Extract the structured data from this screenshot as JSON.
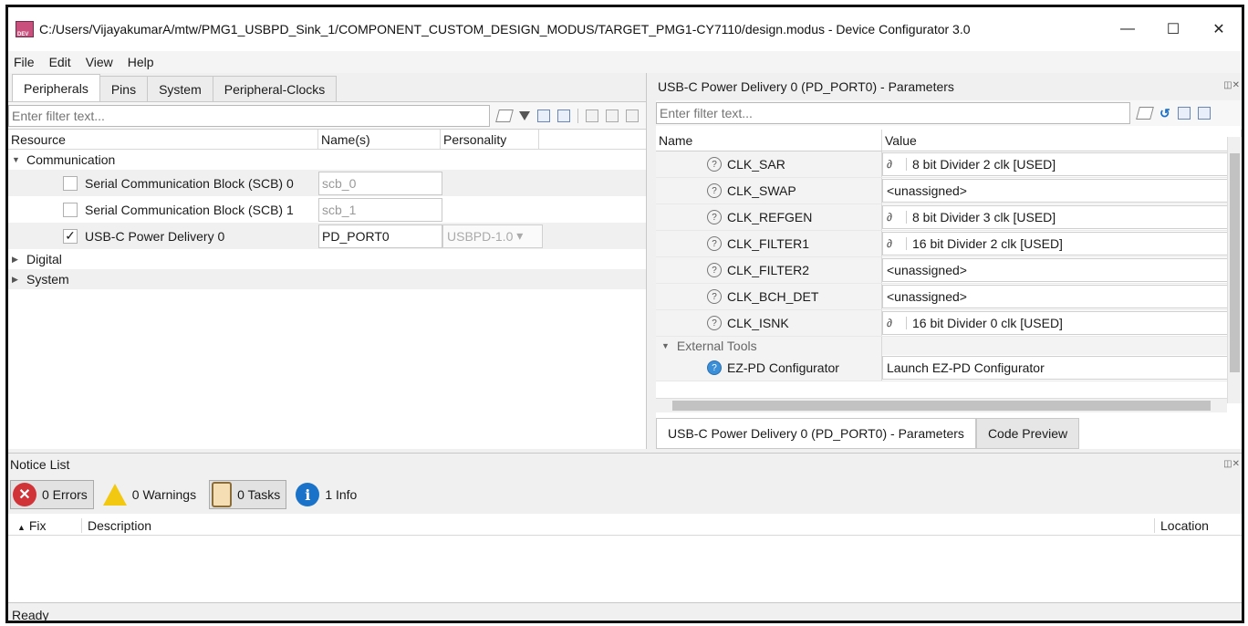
{
  "window": {
    "title": "C:/Users/VijayakumarA/mtw/PMG1_USBPD_Sink_1/COMPONENT_CUSTOM_DESIGN_MODUS/TARGET_PMG1-CY7110/design.modus - Device Configurator 3.0",
    "minimize": "—",
    "maximize": "☐",
    "close": "✕"
  },
  "menu": {
    "file": "File",
    "edit": "Edit",
    "view": "View",
    "help": "Help"
  },
  "left": {
    "tabs": [
      "Peripherals",
      "Pins",
      "System",
      "Peripheral-Clocks"
    ],
    "filter_placeholder": "Enter filter text...",
    "columns": {
      "resource": "Resource",
      "names": "Name(s)",
      "personality": "Personality"
    },
    "groups": {
      "communication": "Communication",
      "digital": "Digital",
      "system": "System"
    },
    "rows": [
      {
        "label": "Serial Communication Block (SCB) 0",
        "name": "scb_0",
        "checked": false
      },
      {
        "label": "Serial Communication Block (SCB) 1",
        "name": "scb_1",
        "checked": false
      },
      {
        "label": "USB-C Power Delivery 0",
        "name": "PD_PORT0",
        "checked": true,
        "personality": "USBPD-1.0"
      }
    ],
    "check_mark": "✓"
  },
  "right": {
    "title": "USB-C Power Delivery 0 (PD_PORT0) - Parameters",
    "filter_placeholder": "Enter filter text...",
    "columns": {
      "name": "Name",
      "value": "Value"
    },
    "params": [
      {
        "name": "CLK_SAR",
        "value": "8 bit Divider 2 clk [USED]",
        "linked": true
      },
      {
        "name": "CLK_SWAP",
        "value": "<unassigned>",
        "linked": false
      },
      {
        "name": "CLK_REFGEN",
        "value": "8 bit Divider 3 clk [USED]",
        "linked": true
      },
      {
        "name": "CLK_FILTER1",
        "value": "16 bit Divider 2 clk [USED]",
        "linked": true
      },
      {
        "name": "CLK_FILTER2",
        "value": "<unassigned>",
        "linked": false
      },
      {
        "name": "CLK_BCH_DET",
        "value": "<unassigned>",
        "linked": false
      },
      {
        "name": "CLK_ISNK",
        "value": "16 bit Divider 0 clk [USED]",
        "linked": true
      }
    ],
    "section_external": "External Tools",
    "ezpd": {
      "name": "EZ-PD Configurator",
      "value": "Launch EZ-PD Configurator"
    },
    "bottom_tabs": [
      "USB-C Power Delivery 0 (PD_PORT0) - Parameters",
      "Code Preview"
    ]
  },
  "notice": {
    "title": "Notice List",
    "errors": "0 Errors",
    "warnings": "0 Warnings",
    "tasks": "0 Tasks",
    "info": "1 Info",
    "columns": {
      "fix": "Fix",
      "description": "Description",
      "location": "Location"
    }
  },
  "status": "Ready"
}
